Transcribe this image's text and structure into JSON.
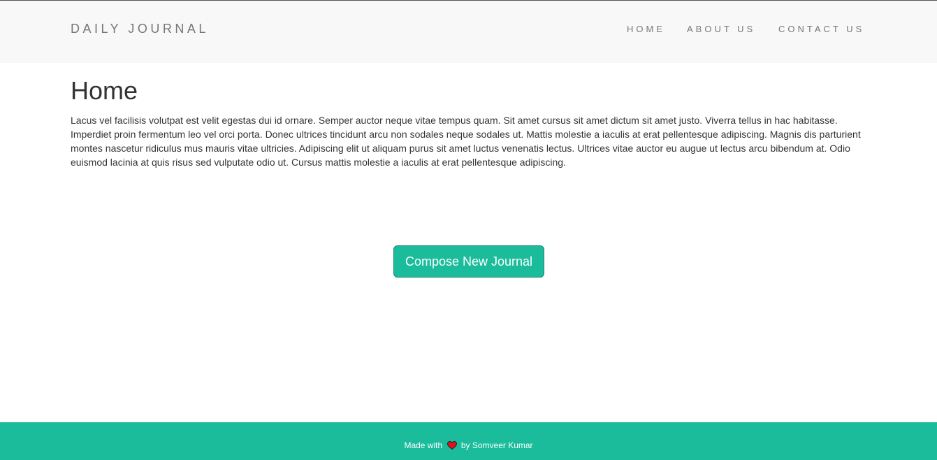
{
  "navbar": {
    "brand": "DAILY JOURNAL",
    "links": [
      {
        "label": "HOME"
      },
      {
        "label": "ABOUT US"
      },
      {
        "label": "CONTACT US"
      }
    ]
  },
  "main": {
    "title": "Home",
    "content": "Lacus vel facilisis volutpat est velit egestas dui id ornare. Semper auctor neque vitae tempus quam. Sit amet cursus sit amet dictum sit amet justo. Viverra tellus in hac habitasse. Imperdiet proin fermentum leo vel orci porta. Donec ultrices tincidunt arcu non sodales neque sodales ut. Mattis molestie a iaculis at erat pellentesque adipiscing. Magnis dis parturient montes nascetur ridiculus mus mauris vitae ultricies. Adipiscing elit ut aliquam purus sit amet luctus venenatis lectus. Ultrices vitae auctor eu augue ut lectus arcu bibendum at. Odio euismod lacinia at quis risus sed vulputate odio ut. Cursus mattis molestie a iaculis at erat pellentesque adipiscing.",
    "compose_label": "Compose New Journal"
  },
  "footer": {
    "prefix": "Made with",
    "icon": "heart-icon",
    "suffix": "by Somveer Kumar"
  },
  "colors": {
    "accent": "#1abc9c",
    "navbar_bg": "#f8f8f8",
    "heart": "#e0101e"
  }
}
